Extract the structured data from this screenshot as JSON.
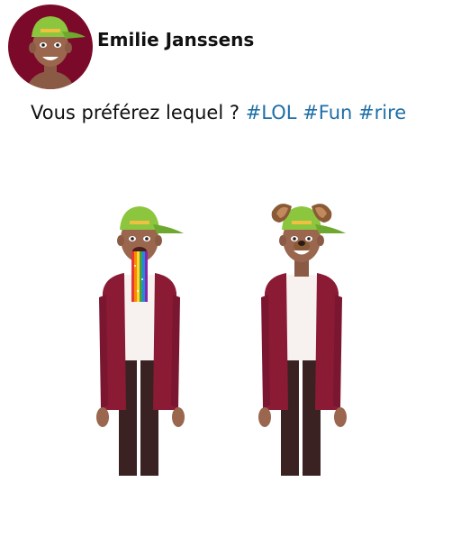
{
  "post": {
    "author": "Emilie Janssens",
    "text": "Vous préférez lequel ?",
    "hashtags": [
      "#LOL",
      "#Fun",
      "#rire"
    ]
  },
  "illustration": {
    "left_filter": "rainbow",
    "right_filter": "dog"
  },
  "colors": {
    "avatar_bg": "#7b0a2a",
    "cap": "#8cc63f",
    "jacket": "#8b1a35",
    "hashtag": "#1f6fa8"
  }
}
